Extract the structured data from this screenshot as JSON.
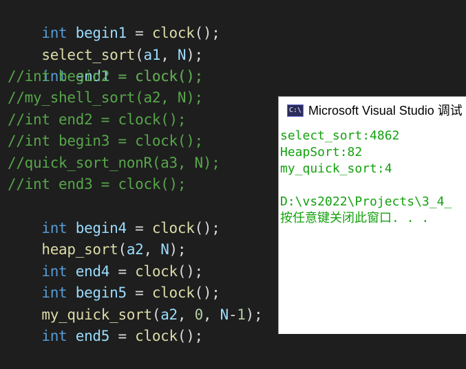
{
  "editor": {
    "lines": [
      [
        "int",
        " ",
        "begin1",
        " = ",
        "clock",
        "();"
      ],
      [
        "select_sort",
        "(",
        "a1",
        ", ",
        "N",
        ");"
      ],
      [
        "int",
        " ",
        "end1",
        " = ",
        "clock",
        "();"
      ],
      "//int begin2 = clock();",
      "//my_shell_sort(a2, N);",
      "//int end2 = clock();",
      "//int begin3 = clock();",
      "//quick_sort_nonR(a3, N);",
      "//int end3 = clock();",
      [
        "int",
        " ",
        "begin4",
        " = ",
        "clock",
        "();"
      ],
      [
        "heap_sort",
        "(",
        "a2",
        ", ",
        "N",
        ");"
      ],
      [
        "int",
        " ",
        "end4",
        " = ",
        "clock",
        "();"
      ],
      [
        "int",
        " ",
        "begin5",
        " = ",
        "clock",
        "();"
      ],
      [
        "my_quick_sort",
        "(",
        "a2",
        ", ",
        "0",
        ", ",
        "N",
        "-",
        "1",
        ");"
      ],
      [
        "int",
        " ",
        "end5",
        " = ",
        "clock",
        "();"
      ]
    ]
  },
  "console": {
    "title": "Microsoft Visual Studio 调试",
    "icon": "console-app-icon",
    "icon_text": "C:\\",
    "output": [
      "select_sort:4862",
      "HeapSort:82",
      "my_quick_sort:4",
      "",
      "D:\\vs2022\\Projects\\3_4_",
      "按任意键关闭此窗口. . ."
    ]
  },
  "colors": {
    "editor_bg": "#1e1e1e",
    "keyword": "#569cd6",
    "function": "#dcdcaa",
    "variable": "#9cdcfe",
    "number": "#b5cea8",
    "comment": "#57a64a",
    "console_text": "#13a10e",
    "console_bg": "#ffffff"
  }
}
